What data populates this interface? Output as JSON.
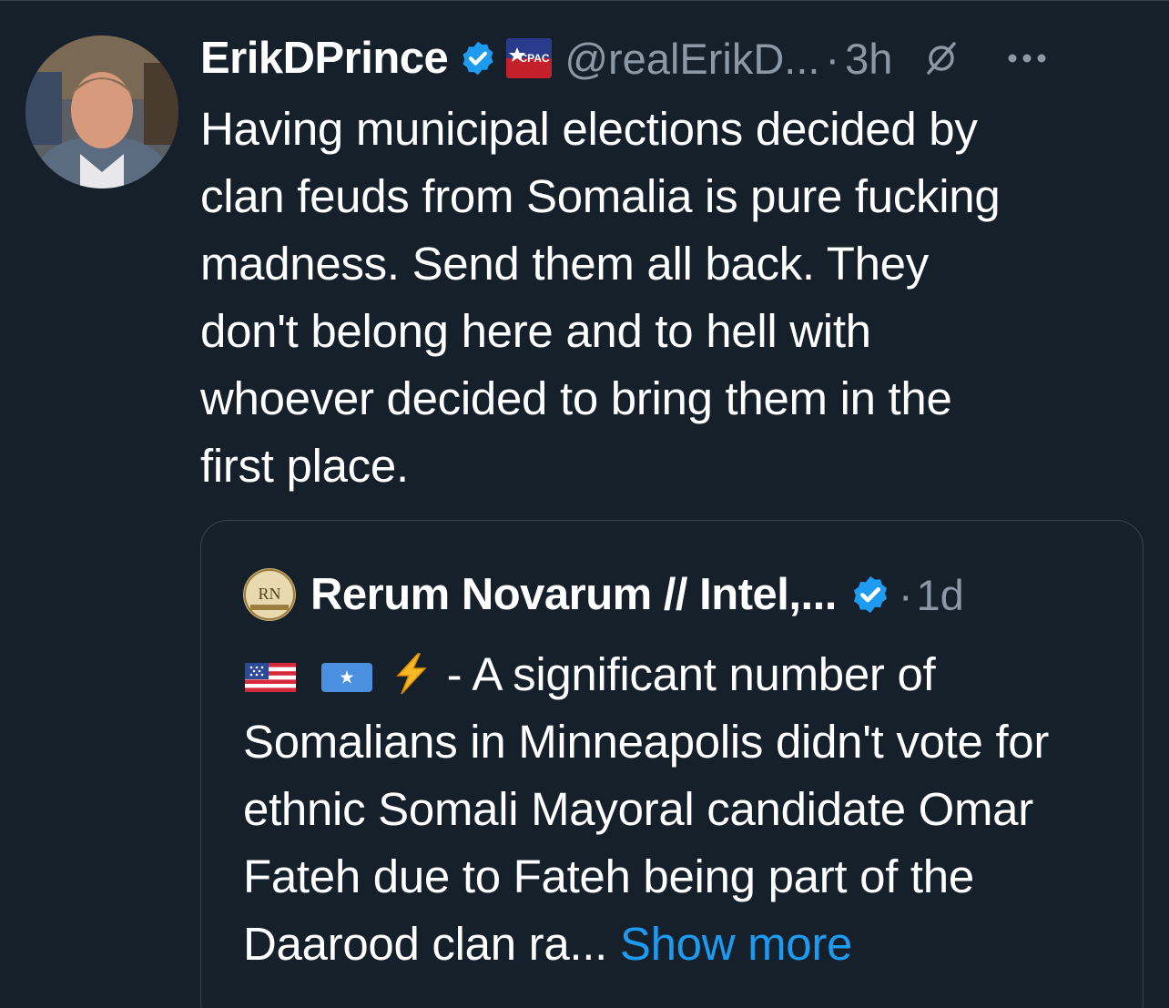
{
  "tweet": {
    "author_name": "ErikDPrince",
    "handle": "@realErikD...",
    "separator": "·",
    "time": "3h",
    "affiliate_badge_text": "CPAC",
    "body": "Having municipal elections decided by\nclan feuds from Somalia is pure fucking\nmadness. Send them all back. They\ndon't belong here and to hell with\nwhoever decided to bring them in the\nfirst place."
  },
  "quote": {
    "avatar_initials": "RN",
    "author_name": "Rerum Novarum // Intel,...",
    "separator": "·",
    "time": "1d",
    "emoji_separator": " - ",
    "body_text": "A significant number of Somalians in Minneapolis didn't vote for ethnic Somali Mayoral candidate Omar Fateh due to Fateh being part of the Daarood clan ra...",
    "show_more": "Show more"
  },
  "icons": {
    "verified": "verified-badge-icon",
    "affiliate": "cpac-badge-icon",
    "grok": "grok-icon",
    "more": "more-dots-icon",
    "flag_us": "us-flag-emoji",
    "flag_somalia": "somalia-flag-emoji",
    "lightning": "lightning-emoji"
  },
  "colors": {
    "background": "#15202b",
    "text": "#ffffff",
    "secondary_text": "#8b98a5",
    "link": "#1d9bf0",
    "verified": "#1d9bf0",
    "border": "#38444d"
  }
}
